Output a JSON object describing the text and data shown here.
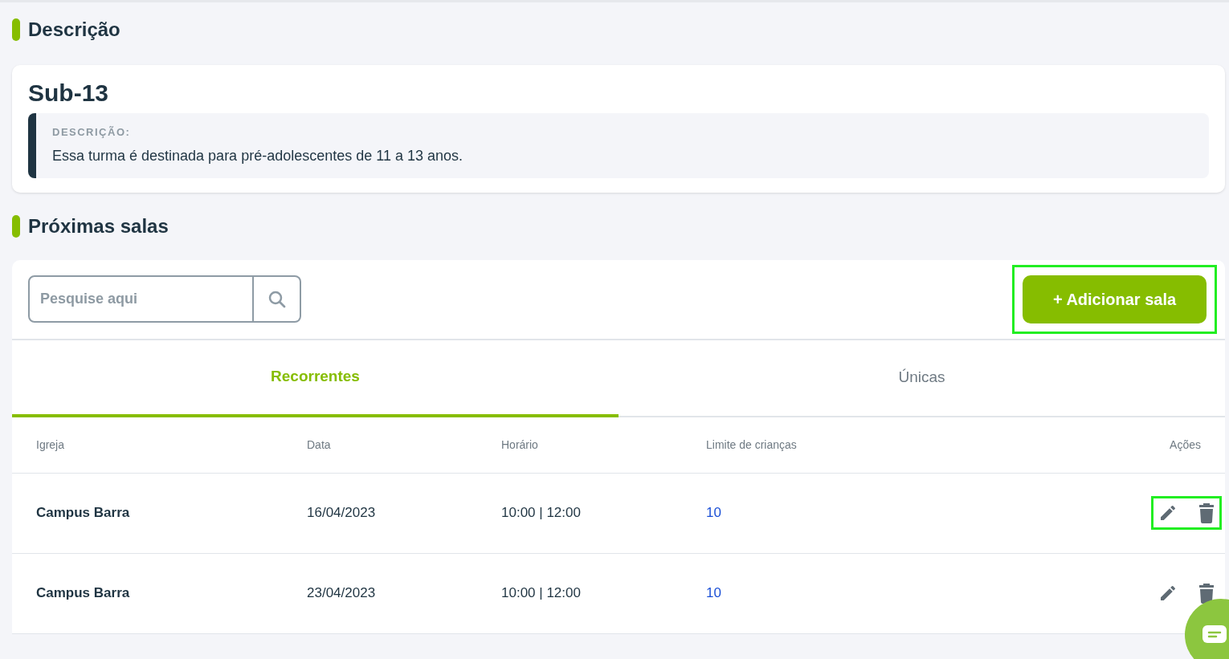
{
  "sections": [
    {
      "title": "Descrição"
    },
    {
      "title": "Próximas salas"
    }
  ],
  "group": {
    "name": "Sub-13",
    "label": "DESCRIÇÃO:",
    "text": "Essa turma é destinada para pré-adolescentes de 11 a 13 anos."
  },
  "search": {
    "placeholder": "Pesquise aqui"
  },
  "add_button": {
    "label": "+ Adicionar sala",
    "highlighted": true
  },
  "tabs": [
    {
      "label": "Recorrentes",
      "selected": true
    },
    {
      "label": "Únicas",
      "selected": false
    }
  ],
  "table": {
    "columns": [
      "Igreja",
      "Data",
      "Horário",
      "Limite de crianças",
      "Ações"
    ],
    "rows": [
      {
        "church": "Campus Barra",
        "date": "16/04/2023",
        "time": "10:00 | 12:00",
        "limit": "10",
        "actions_highlighted": true
      },
      {
        "church": "Campus Barra",
        "date": "23/04/2023",
        "time": "10:00 | 12:00",
        "limit": "10",
        "actions_highlighted": false
      }
    ]
  }
}
